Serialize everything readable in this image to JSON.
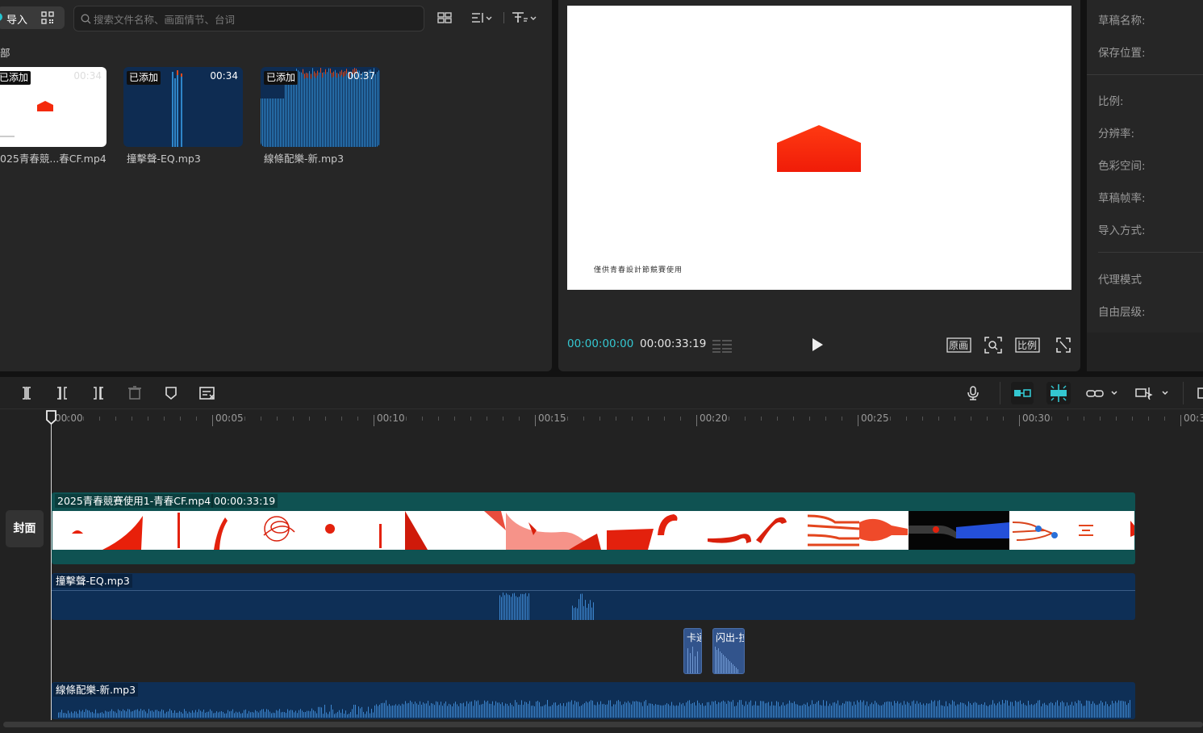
{
  "media": {
    "import_label": "导入",
    "search_placeholder": "搜索文件名称、画面情节、台词",
    "breadcrumb": "部",
    "items": [
      {
        "name": "025青春競...春CF.mp4",
        "badge": "已添加",
        "duration": "00:34",
        "type": "video"
      },
      {
        "name": "撞擊聲-EQ.mp3",
        "badge": "已添加",
        "duration": "00:34",
        "type": "audio"
      },
      {
        "name": "線條配樂-新.mp3",
        "badge": "已添加",
        "duration": "00:37",
        "type": "audio"
      }
    ]
  },
  "preview": {
    "caption": "僅供青春設計節競賽使用",
    "current_time": "00:00:00:00",
    "total_time": "00:00:33:19",
    "original_label": "原画",
    "ratio_label": "比例"
  },
  "properties": {
    "draft_name": "草稿名称:",
    "save_location": "保存位置:",
    "ratio": "比例:",
    "resolution": "分辨率:",
    "color_space": "色彩空间:",
    "frame_rate": "草稿帧率:",
    "import_mode": "导入方式:",
    "proxy_mode": "代理模式",
    "free_layer": "自由层级:"
  },
  "timeline": {
    "ruler": [
      "00:00",
      "00:05",
      "00:10",
      "00:15",
      "00:20",
      "00:25",
      "00:30",
      "00:3"
    ],
    "cover_label": "封面",
    "video_clip": {
      "name": "2025青春競賽使用1-青春CF.mp4",
      "duration": "00:00:33:19"
    },
    "audio1": {
      "name": "撞擊聲-EQ.mp3"
    },
    "sfx1": {
      "name": "卡通"
    },
    "sfx2": {
      "name": "闪出-拉"
    },
    "audio2": {
      "name": "線條配樂-新.mp3"
    }
  },
  "colors": {
    "accent": "#34c7d1",
    "video_track": "#0f5252",
    "audio_track": "#0e2f56",
    "brand_red": "#f42a0c"
  }
}
